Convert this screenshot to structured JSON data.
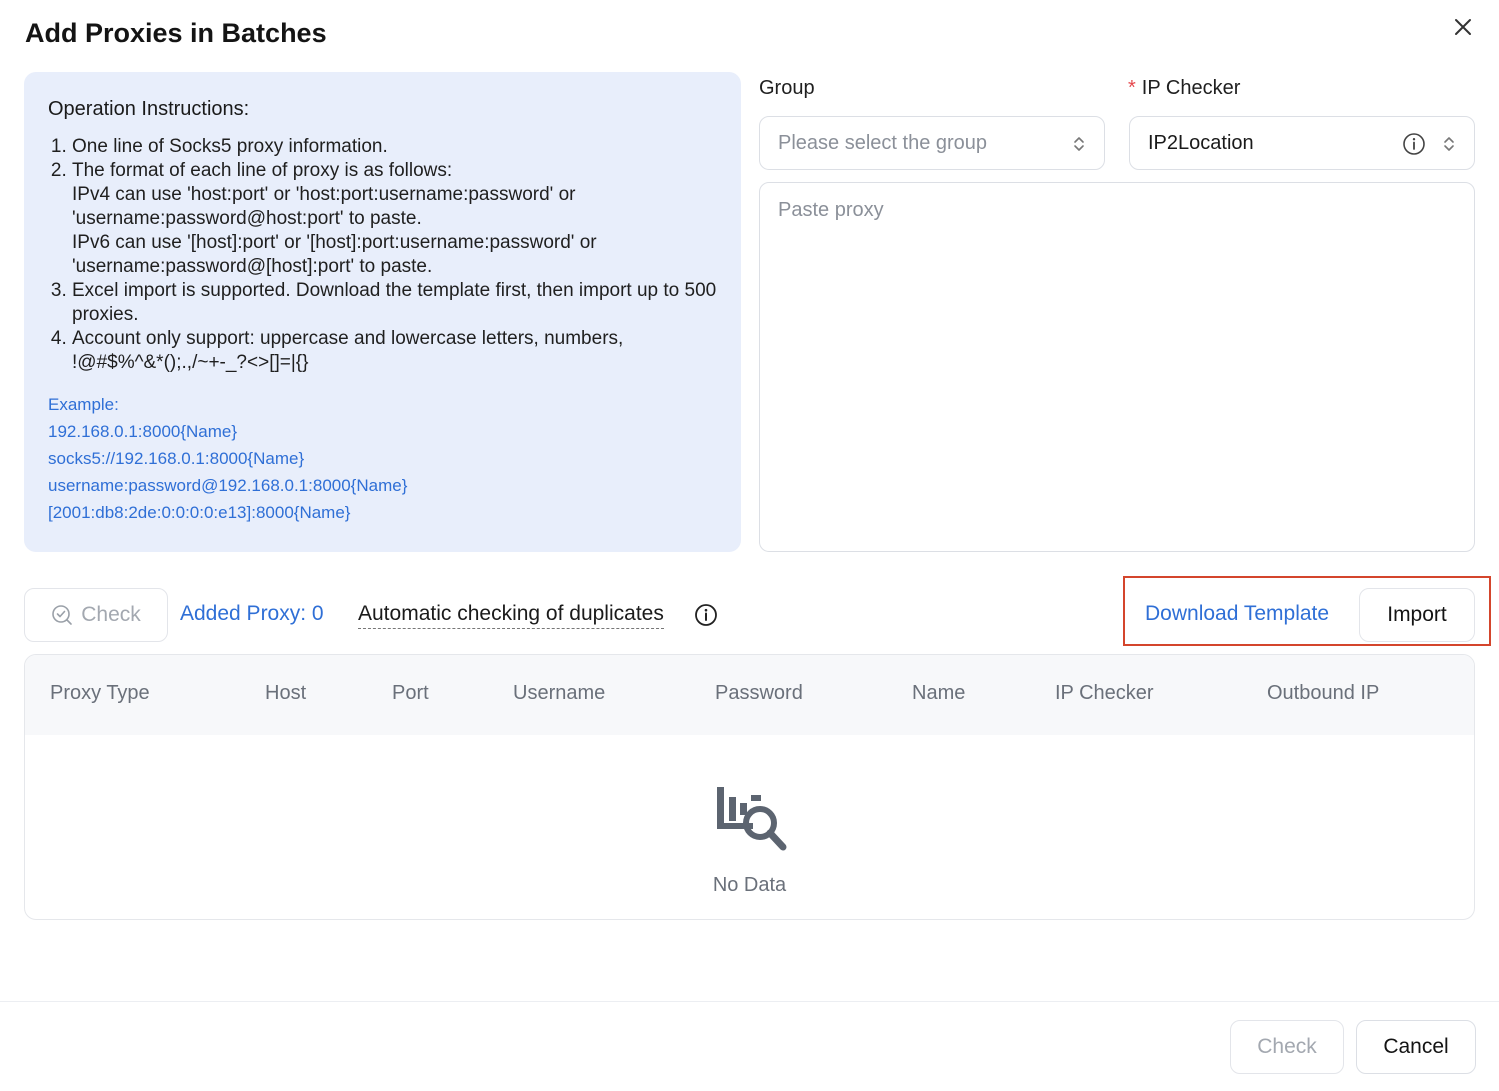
{
  "dialog": {
    "title": "Add Proxies in Batches"
  },
  "instructions": {
    "heading": "Operation Instructions:",
    "items": [
      "One line of Socks5 proxy information.",
      "The format of each line of proxy is as follows:",
      "Excel import is supported. Download the template first, then import up to 500 proxies.",
      "Account only support: uppercase and lowercase letters, numbers, !@#$%^&*();.,/~+-_?<>[]=|{}"
    ],
    "item2_lines": [
      "IPv4 can use 'host:port' or 'host:port:username:password' or",
      "'username:password@host:port' to paste.",
      "IPv6 can use '[host]:port' or '[host]:port:username:password' or",
      "'username:password@[host]:port' to paste."
    ],
    "example_label": "Example:",
    "examples": [
      "192.168.0.1:8000{Name}",
      "socks5://192.168.0.1:8000{Name}",
      "username:password@192.168.0.1:8000{Name}",
      "[2001:db8:2de:0:0:0:0:e13]:8000{Name}"
    ]
  },
  "form": {
    "group_label": "Group",
    "group_placeholder": "Please select the group",
    "ip_checker_required_mark": "*",
    "ip_checker_label": "IP Checker",
    "ip_checker_value": "IP2Location",
    "proxy_placeholder": "Paste proxy"
  },
  "toolbar": {
    "check_label": "Check",
    "added_proxy": "Added Proxy: 0",
    "duplicates_label": "Automatic checking of duplicates",
    "download_template": "Download Template",
    "import_label": "Import"
  },
  "table": {
    "columns": [
      "Proxy Type",
      "Host",
      "Port",
      "Username",
      "Password",
      "Name",
      "IP Checker",
      "Outbound IP"
    ],
    "empty_text": "No Data"
  },
  "footer": {
    "check_label": "Check",
    "cancel_label": "Cancel"
  },
  "colors": {
    "accent": "#2f6fd6",
    "instructions_bg": "#e8eefb",
    "highlight": "#d4452c",
    "required": "#e5484d"
  }
}
